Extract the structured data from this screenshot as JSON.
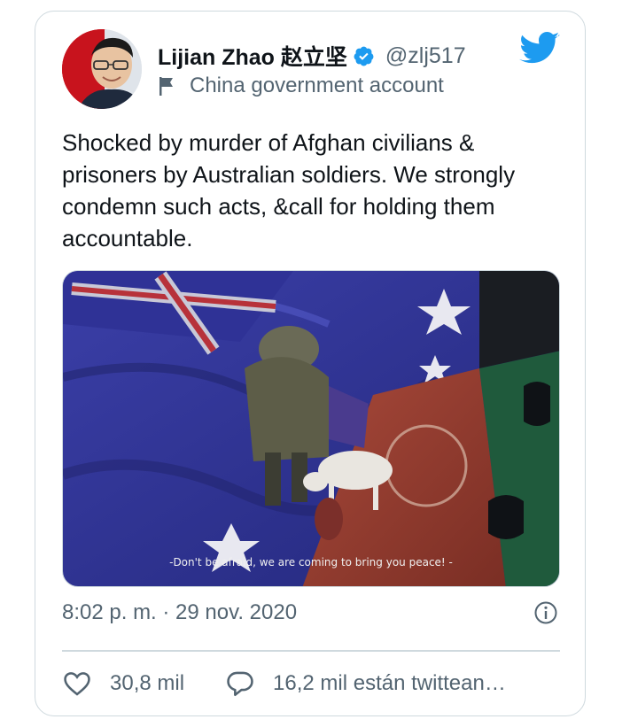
{
  "author": {
    "display_name": "Lijian Zhao 赵立坚",
    "handle": "@zlj517",
    "verified": true,
    "label": "China government account",
    "avatar_icon": "avatar-photo"
  },
  "tweet": {
    "text": "Shocked by murder of Afghan civilians & prisoners by Australian soldiers. We strongly condemn such acts, &call for holding them accountable.",
    "media": {
      "caption": "-Don't be afraid, we are coming to bring you peace! -"
    },
    "timestamp": "8:02 p. m. · 29 nov. 2020"
  },
  "actions": {
    "likes": "30,8 mil",
    "replies": "16,2 mil están twittean…"
  },
  "colors": {
    "brand": "#1d9bf0",
    "secondary_text": "#536471",
    "border": "#cfd9de"
  }
}
